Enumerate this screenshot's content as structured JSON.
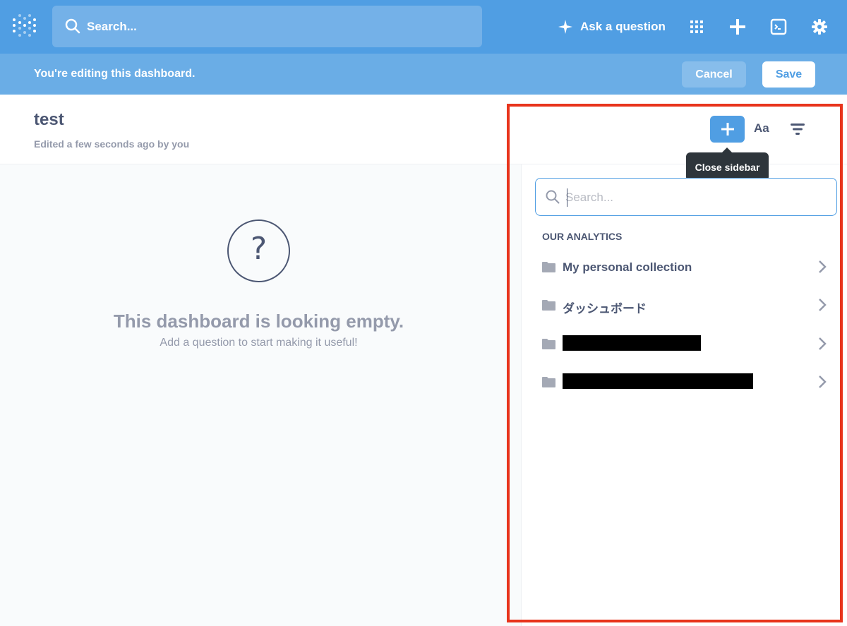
{
  "colors": {
    "brand": "#509ee3",
    "edit_bar": "#6aade6",
    "text_dark": "#4c5773",
    "text_light": "#949aab",
    "highlight_frame": "#e8341c"
  },
  "topnav": {
    "logo_icon": "metabase-logo-icon",
    "search_placeholder": "Search...",
    "ask_label": "Ask a question",
    "icons": [
      "grid-icon",
      "plus-icon",
      "terminal-icon",
      "gear-icon"
    ]
  },
  "editbar": {
    "message": "You're editing this dashboard.",
    "cancel_label": "Cancel",
    "save_label": "Save"
  },
  "dashboard": {
    "title": "test",
    "subtitle": "Edited a few seconds ago by you",
    "empty_icon": "?",
    "empty_title": "This dashboard is looking empty.",
    "empty_subtitle": "Add a question to start making it useful!"
  },
  "sidebar": {
    "toolbar": {
      "add_icon": "plus-icon",
      "text_label": "Aa",
      "filter_icon": "filter-icon"
    },
    "tooltip": "Close sidebar",
    "search_placeholder": "Search...",
    "section_label": "OUR ANALYTICS",
    "collections": [
      {
        "label": "My personal collection",
        "redacted": false
      },
      {
        "label": "ダッシュボード",
        "redacted": false
      },
      {
        "label": "",
        "redacted": true
      },
      {
        "label": "",
        "redacted": true
      }
    ]
  }
}
